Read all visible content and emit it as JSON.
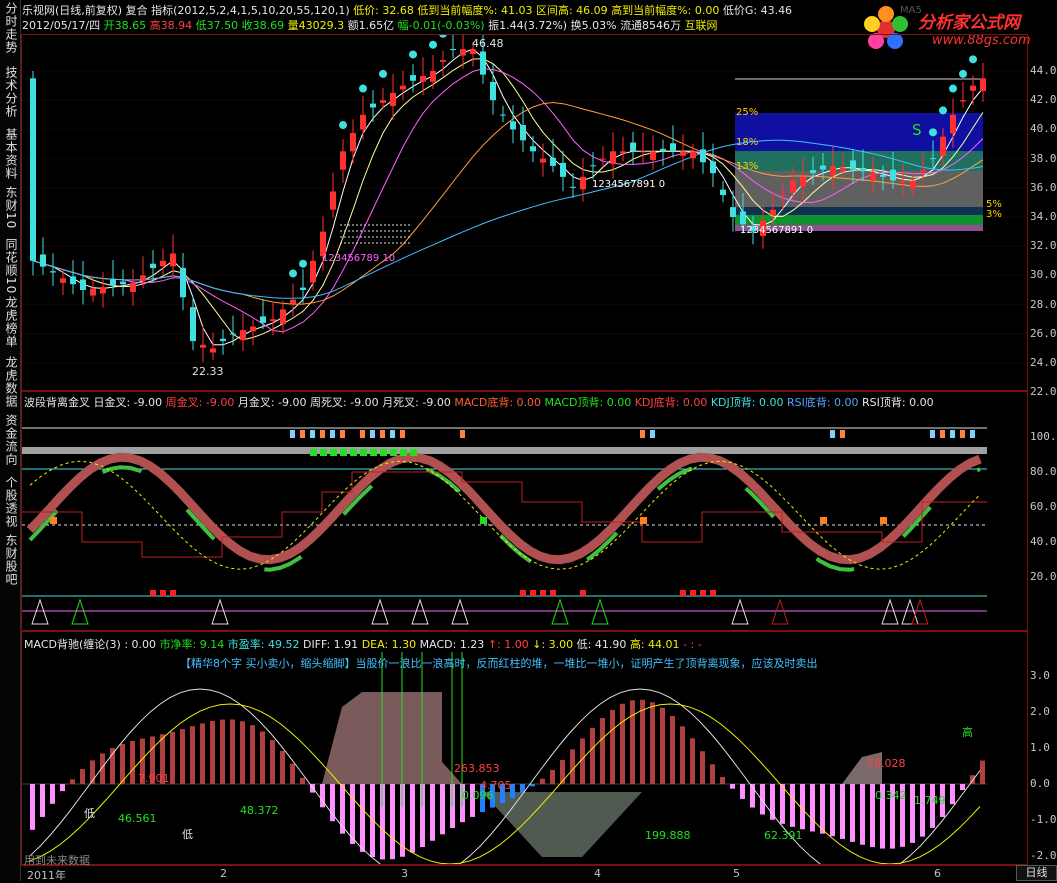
{
  "sidebar": {
    "items": [
      "分时走势",
      "技术分析",
      "基本资料",
      "东财10",
      "同花顺10",
      "龙虎榜单",
      "龙虎数据",
      "资金流向",
      "个股透视",
      "东财股吧"
    ]
  },
  "header": {
    "line1": {
      "title": "乐视网(日线,前复权)",
      "mode": "复合",
      "indicator": "指标(2012,5,2,4,1,5,10,20,55,120,1)",
      "low_label": "低价: 32.68",
      "drop_label": "低到当前幅度%: 41.03",
      "range_high": "区间高: 46.09",
      "rise_label": "高到当前幅度%: 0.00",
      "lowg": "低价G: 43.46"
    },
    "line2": {
      "date": "2012/05/17/四",
      "open": "开38.65",
      "high": "高38.94",
      "low": "低37.50",
      "close": "收38.69",
      "volume": "量43029.3",
      "amount": "额1.65亿",
      "change": "幅-0.01(-0.03%)",
      "amplitude": "振1.44(3.72%)",
      "turnover": "换5.03%",
      "float": "流通8546万",
      "board": "互联网"
    },
    "ma_label": "MA5"
  },
  "watermark": {
    "name": "分析家公式网",
    "url": "www.88gs.com"
  },
  "main_chart": {
    "y_ticks": [
      "44.00",
      "42.00",
      "40.00",
      "38.00",
      "36.00",
      "34.00",
      "32.00",
      "30.00",
      "28.00",
      "26.00",
      "24.00",
      "22.00"
    ],
    "price_labels": {
      "high": "46.48",
      "low": "22.33"
    },
    "sequence_label": "123456789 10",
    "sequence_label2": "1234567891 0",
    "sequence_label3": "1234567891 0",
    "fib": [
      "25%",
      "18%",
      "13%",
      "5%",
      "3%"
    ],
    "s_mark": "S"
  },
  "indicator1": {
    "title": "波段背离金叉",
    "items": [
      {
        "label": "日金叉: -9.00",
        "color": "#e6e6e6"
      },
      {
        "label": "周金叉: -9.00",
        "color": "#ff4040"
      },
      {
        "label": "月金叉: -9.00",
        "color": "#e6e6e6"
      },
      {
        "label": "周死叉: -9.00",
        "color": "#e6e6e6"
      },
      {
        "label": "月死叉: -9.00",
        "color": "#e6e6e6"
      },
      {
        "label": "MACD底背: 0.00",
        "color": "#ff6030"
      },
      {
        "label": "MACD顶背: 0.00",
        "color": "#20e020"
      },
      {
        "label": "KDJ底背: 0.00",
        "color": "#ff4040"
      },
      {
        "label": "KDJ顶背: 0.00",
        "color": "#40e0e0"
      },
      {
        "label": "RSI底背: 0.00",
        "color": "#5aa0ff"
      },
      {
        "label": "RSI顶背: 0.00",
        "color": "#e6e6e6"
      }
    ],
    "y_ticks": [
      "100.0",
      "80.0",
      "60.0",
      "40.0",
      "20.0"
    ]
  },
  "indicator2": {
    "title": "MACD背驰(缠论(3)",
    "items": [
      {
        "label": ": 0.00",
        "color": "#e6e6e6"
      },
      {
        "label": "市净率: 9.14",
        "color": "#20e020"
      },
      {
        "label": "市盈率: 49.52",
        "color": "#40e0e0"
      },
      {
        "label": "DIFF: 1.91",
        "color": "#e6e6e6"
      },
      {
        "label": "DEA: 1.30",
        "color": "#f0f000"
      },
      {
        "label": "MACD: 1.23",
        "color": "#e6e6e6"
      },
      {
        "label": "↑: 1.00",
        "color": "#ff4040"
      },
      {
        "label": "↓: 3.00",
        "color": "#f0f000"
      },
      {
        "label": "低: 41.90",
        "color": "#e6e6e6"
      },
      {
        "label": "高: 44.01",
        "color": "#f0f000"
      },
      {
        "label": "- : -",
        "color": "#ff4040"
      }
    ],
    "note": "【精华8个字 买小卖小，缩头缩脚】当股价一浪比一浪高时，反而红柱的堆，一堆比一堆小，证明产生了顶背离现象，应该及时卖出",
    "y_ticks": [
      "3.0",
      "2.0",
      "1.0",
      "0.0",
      "-1.0",
      "-2.0"
    ],
    "value_labels": [
      "7.901",
      "46.561",
      "48.372",
      "263.853",
      "0.096",
      "4.705",
      "199.888",
      "62.391",
      "58.028",
      "0.342",
      "1.749"
    ],
    "low_mark": "低",
    "high_mark": "高",
    "future_label": "用到未来数据"
  },
  "time_axis": {
    "year": "2011年",
    "months": [
      "2",
      "3",
      "4",
      "5",
      "6"
    ],
    "period_button": "日线"
  },
  "colors": {
    "up": "#ff3030",
    "down": "#40e0e0",
    "frame": "#7a1010",
    "text": "#c0c0c0"
  }
}
